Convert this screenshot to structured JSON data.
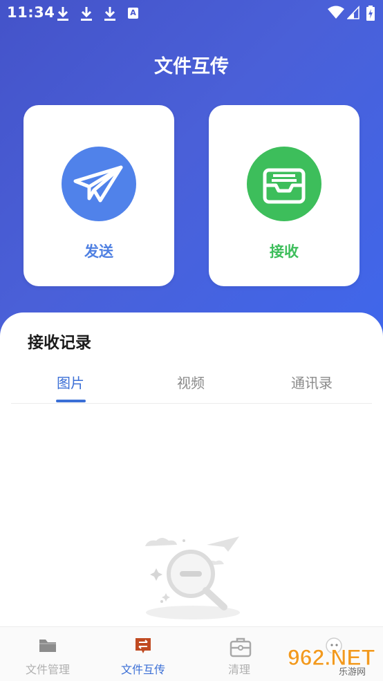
{
  "status_bar": {
    "time": "11:34",
    "notif_letter": "A"
  },
  "header": {
    "title": "文件互传"
  },
  "actions": {
    "send": {
      "label": "发送",
      "color": "#5082ea",
      "icon": "paper-plane-icon"
    },
    "receive": {
      "label": "接收",
      "color": "#3dbe5b",
      "icon": "inbox-tray-icon"
    }
  },
  "records": {
    "title": "接收记录",
    "tabs": [
      {
        "label": "图片",
        "active": true
      },
      {
        "label": "视频",
        "active": false
      },
      {
        "label": "通讯录",
        "active": false
      }
    ],
    "empty_icon": "empty-search-icon"
  },
  "bottom_nav": [
    {
      "label": "文件管理",
      "icon": "folder-icon",
      "active": false
    },
    {
      "label": "文件互传",
      "icon": "transfer-icon",
      "active": true
    },
    {
      "label": "清理",
      "icon": "briefcase-icon",
      "active": false
    }
  ],
  "watermark": {
    "text": "962.NET",
    "sub": "乐游网"
  },
  "colors": {
    "accent": "#3b6fd6",
    "gradient_start": "#4453c9",
    "gradient_end": "#3f67ec"
  }
}
